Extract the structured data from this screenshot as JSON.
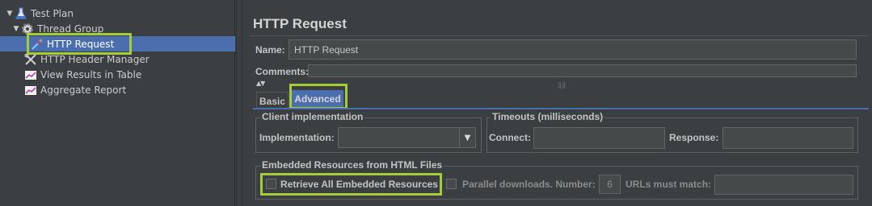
{
  "tree": {
    "items": [
      {
        "label": "Test Plan",
        "icon": "flask-icon"
      },
      {
        "label": "Thread Group",
        "icon": "gear-icon"
      },
      {
        "label": "HTTP Request",
        "icon": "pipette-icon"
      },
      {
        "label": "HTTP Header Manager",
        "icon": "wrench-icon"
      },
      {
        "label": "View Results in Table",
        "icon": "chart-icon"
      },
      {
        "label": "Aggregate Report",
        "icon": "chart-icon"
      }
    ]
  },
  "panel": {
    "title": "HTTP Request",
    "name_label": "Name:",
    "name_value": "HTTP Request",
    "comments_label": "Comments:",
    "tabs": [
      {
        "label": "Basic"
      },
      {
        "label": "Advanced"
      }
    ],
    "client": {
      "group_title": "Client implementation",
      "implementation_label": "Implementation:",
      "implementation_value": ""
    },
    "timeouts": {
      "group_title": "Timeouts (milliseconds)",
      "connect_label": "Connect:",
      "response_label": "Response:"
    },
    "embedded": {
      "group_title": "Embedded Resources from HTML Files",
      "retrieve_label": "Retrieve All Embedded Resources",
      "parallel_label": "Parallel downloads. Number:",
      "parallel_value": "6",
      "urls_label": "URLs must match:"
    }
  },
  "colors": {
    "background": "#3c3f41",
    "selection": "#4b6eaf",
    "highlight": "#a4cd39"
  }
}
